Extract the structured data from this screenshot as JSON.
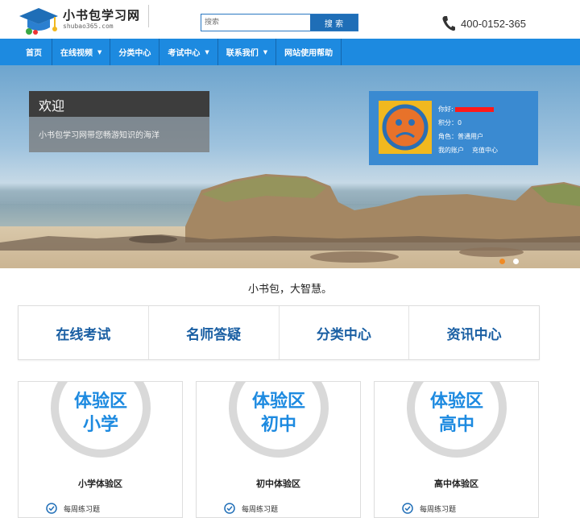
{
  "brand": {
    "title": "小书包学习网",
    "subtitle": "shubao365.com"
  },
  "search": {
    "placeholder": "搜索",
    "button": "搜 索"
  },
  "phone": "400-0152-365",
  "nav": [
    {
      "label": "首页",
      "dropdown": false
    },
    {
      "label": "在线视频",
      "dropdown": true
    },
    {
      "label": "分类中心",
      "dropdown": false
    },
    {
      "label": "考试中心",
      "dropdown": true
    },
    {
      "label": "联系我们",
      "dropdown": true
    },
    {
      "label": "网站使用帮助",
      "dropdown": false
    }
  ],
  "welcome": {
    "title": "欢迎",
    "subtitle": "小书包学习网带您畅游知识的海洋"
  },
  "user": {
    "greeting": "你好:",
    "points_label": "积分：",
    "points": "0",
    "role_label": "角色：",
    "role": "普通用户",
    "account_link": "我的账户",
    "recharge_link": "充值中心"
  },
  "slogan": "小书包，大智慧。",
  "quick_links": [
    "在线考试",
    "名师答疑",
    "分类中心",
    "资讯中心"
  ],
  "cards": [
    {
      "badge_top": "体验区",
      "badge_bottom": "小学",
      "title": "小学体验区",
      "feature": "每周练习题"
    },
    {
      "badge_top": "体验区",
      "badge_bottom": "初中",
      "title": "初中体验区",
      "feature": "每周练习题"
    },
    {
      "badge_top": "体验区",
      "badge_bottom": "高中",
      "title": "高中体验区",
      "feature": "每周练习题"
    }
  ],
  "colors": {
    "nav": "#1d8ae0",
    "accent": "#1d8ae0",
    "card_panel": "#3a8ad1",
    "active_dot": "#f08a24"
  }
}
